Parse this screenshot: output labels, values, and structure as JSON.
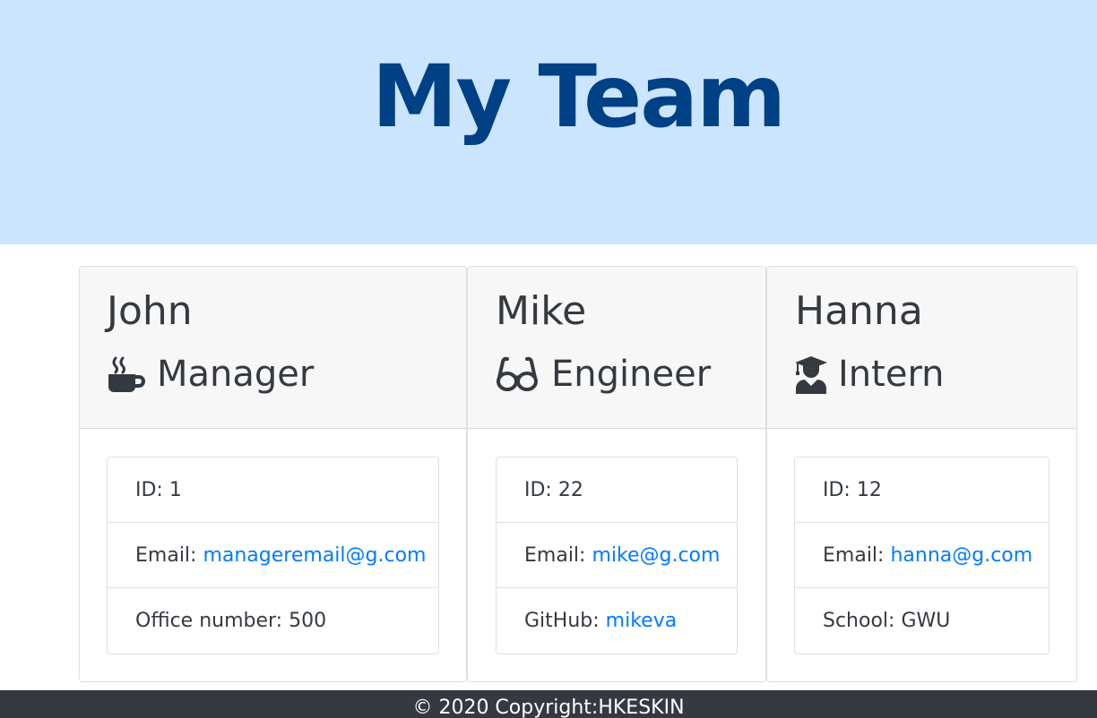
{
  "header": {
    "title": "My Team",
    "background": "#cce5ff",
    "title_color": "#004085"
  },
  "members": [
    {
      "name": "John",
      "role": "Manager",
      "role_icon": "coffee-mug-icon",
      "id_label": "ID:",
      "id": "1",
      "email_label": "Email:",
      "email": "manageremail@g.com",
      "extra_label": "Office number:",
      "extra_value": "500"
    },
    {
      "name": "Mike",
      "role": "Engineer",
      "role_icon": "glasses-icon",
      "id_label": "ID:",
      "id": "22",
      "email_label": "Email:",
      "email": "mike@g.com",
      "extra_label": "GitHub:",
      "extra_value": "mikeva"
    },
    {
      "name": "Hanna",
      "role": "Intern",
      "role_icon": "graduate-icon",
      "id_label": "ID:",
      "id": "12",
      "email_label": "Email:",
      "email": "hanna@g.com",
      "extra_label": "School:",
      "extra_value": "GWU"
    }
  ],
  "footer": {
    "text": "© 2020 Copyright:HKESKIN"
  },
  "colors": {
    "link": "#007bff",
    "footer_bg": "#343a40",
    "card_header_bg": "#f7f7f7"
  }
}
